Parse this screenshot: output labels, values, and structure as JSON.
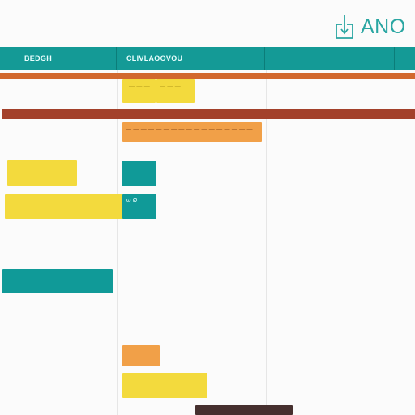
{
  "brand": {
    "name": "ANO",
    "icon": "calendar-icon",
    "color": "#2aa6a2"
  },
  "header": {
    "columns": [
      "BEDGH",
      "CLIVLAOOVOU",
      "",
      ""
    ],
    "background": "#149a96"
  },
  "timeline": {
    "bars": [
      {
        "color": "yellow",
        "label": "— — —"
      },
      {
        "color": "yellow",
        "label": "— — —"
      },
      {
        "color": "orange",
        "label": "— — — — — — — — — — — — — — — — —"
      },
      {
        "color": "yellow",
        "label": ""
      },
      {
        "color": "teal",
        "label": ""
      },
      {
        "color": "yellow",
        "label": ""
      },
      {
        "color": "teal",
        "label": "ω Ø"
      },
      {
        "color": "teal",
        "label": ""
      },
      {
        "color": "orange",
        "label": "— — —"
      },
      {
        "color": "yellow",
        "label": ""
      },
      {
        "color": "dark",
        "label": ""
      }
    ]
  },
  "colors": {
    "teal": "#109a98",
    "yellow": "#f3da3d",
    "orange": "#f1a048",
    "rust": "#d2682e",
    "brown": "#a3412b",
    "dark": "#46302f"
  }
}
